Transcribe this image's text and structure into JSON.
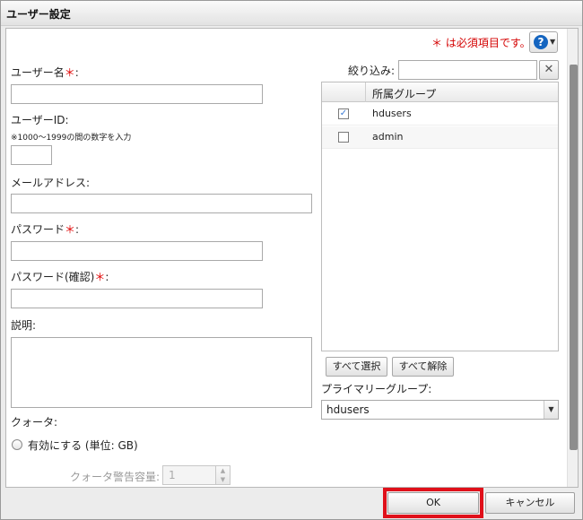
{
  "window": {
    "title": "ユーザー設定"
  },
  "header": {
    "required_note": "＊ は必須項目です。",
    "help_label": "?"
  },
  "form": {
    "username": {
      "label": "ユーザー名",
      "required_mark": "＊",
      "colon": ":",
      "value": ""
    },
    "user_id": {
      "label": "ユーザーID:",
      "hint": "※1000～1999の間の数字を入力",
      "value": ""
    },
    "email": {
      "label": "メールアドレス:",
      "value": ""
    },
    "password": {
      "label": "パスワード",
      "required_mark": "＊",
      "colon": ":",
      "value": ""
    },
    "password_confirm": {
      "label": "パスワード(確認)",
      "required_mark": "＊",
      "colon": ":",
      "value": ""
    },
    "description": {
      "label": "説明:",
      "value": ""
    },
    "quota": {
      "label": "クォータ:",
      "enable_label": "有効にする (単位: GB)",
      "warning_label": "クォータ警告容量:",
      "warning_value": "1"
    }
  },
  "groups": {
    "filter_label": "絞り込み:",
    "filter_value": "",
    "column_header": "所属グループ",
    "items": [
      {
        "name": "hdusers",
        "checked": "✓"
      },
      {
        "name": "admin",
        "checked": ""
      }
    ],
    "select_all": "すべて選択",
    "deselect_all": "すべて解除",
    "primary_label": "プライマリーグループ:",
    "primary_value": "hdusers"
  },
  "footer": {
    "ok": "OK",
    "cancel": "キャンセル"
  },
  "colors": {
    "required": "#e00000",
    "highlight": "#e0101a",
    "help": "#1565c0"
  }
}
